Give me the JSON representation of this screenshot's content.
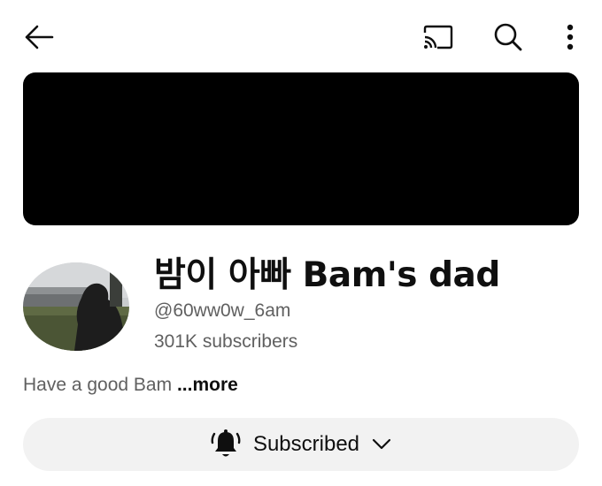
{
  "header": {
    "back_icon": "arrow-left-icon",
    "cast_icon": "cast-icon",
    "search_icon": "search-icon",
    "more_icon": "more-vertical-icon"
  },
  "banner": {
    "color": "#000000"
  },
  "channel": {
    "name": "밤이 아빠 Bam's dad",
    "handle": "@60ww0w_6am",
    "subscribers": "301K subscribers",
    "description": "Have a good Bam ",
    "more_label": "...more"
  },
  "subscribe_button": {
    "label": "Subscribed",
    "bell_icon": "bell-icon",
    "dropdown_icon": "chevron-down-icon"
  }
}
